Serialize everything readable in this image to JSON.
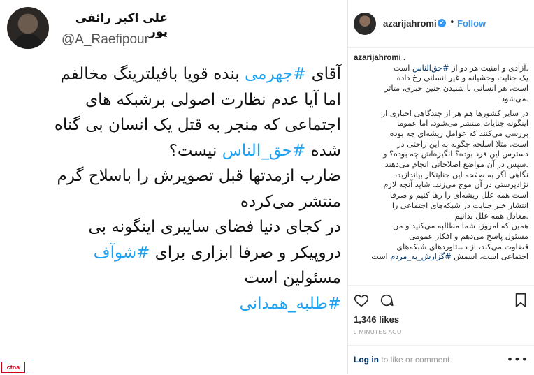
{
  "tweet": {
    "name": "علی اکبر رائفی پور",
    "handle": "@A_Raefipour",
    "lines": [
      {
        "a": "آقای ",
        "h": "#جهرمی",
        "b": " بنده قویا بافیلترینگ مخالفم"
      },
      {
        "a": "اما آیا عدم نظارت اصولی برشبکه های",
        "h": "",
        "b": ""
      },
      {
        "a": "اجتماعی که منجر به قتل یک انسان بی گناه",
        "h": "",
        "b": ""
      },
      {
        "a": "شده ",
        "h": "#حق_الناس",
        "b": " نیست؟"
      },
      {
        "a": "ضارب ازمدتها قبل تصویرش را باسلاح گرم",
        "h": "",
        "b": ""
      },
      {
        "a": "منتشر می‌کرده",
        "h": "",
        "b": ""
      },
      {
        "a": "در کجای دنیا فضای سایبری اینگونه بی",
        "h": "",
        "b": ""
      },
      {
        "a": "دروپیکر و صرفا ابزاری برای ",
        "h": "#شوآف",
        "b": ""
      },
      {
        "a": "مسئولین است",
        "h": "",
        "b": ""
      },
      {
        "a": "",
        "h": "#طلبه_همدانی",
        "b": ""
      }
    ]
  },
  "watermark": "ctna",
  "instagram": {
    "username": "azarijahromi",
    "follow_label": "Follow",
    "caption_user": "azarijahromi .",
    "caption_lines": [
      {
        "t": ".آزادی و امنیت هر دو از ",
        "h": "#حق‌الناس",
        "e": " است"
      },
      {
        "t": "یک جنایت وحشیانه و غیر انسانی رخ داده",
        "h": "",
        "e": ""
      },
      {
        "t": "است، هر انسانی با شنیدن چنین خبری، متاثر",
        "h": "",
        "e": ""
      },
      {
        "t": ".می‌شود",
        "h": "",
        "e": ""
      },
      {
        "t": "",
        "h": "",
        "e": "",
        "gap": true
      },
      {
        "t": "در سایر کشورها هم هر از چندگاهی اخباری از",
        "h": "",
        "e": ""
      },
      {
        "t": "اینگونه جنایات منتشر می‌شود، اما عموما",
        "h": "",
        "e": ""
      },
      {
        "t": "بررسی می‌کنند که عوامل ریشه‌ای چه بوده",
        "h": "",
        "e": ""
      },
      {
        "t": "است. مثلا اسلحه چگونه به این راحتی در",
        "h": "",
        "e": ""
      },
      {
        "t": "دسترس این فرد بوده؟ انگیزه‌اش چه بوده؟ و",
        "h": "",
        "e": ""
      },
      {
        "t": ".سپس در آن مواضع اصلاحاتی انجام می‌دهند",
        "h": "",
        "e": ""
      },
      {
        "t": "نگاهی اگر به صفحه این جنایتکار بیاندازید،",
        "h": "",
        "e": ""
      },
      {
        "t": "نژادپرستی در آن موج می‌زند. شاید آنچه لازم",
        "h": "",
        "e": ""
      },
      {
        "t": "است همه علل ریشه‌ای را رها کنیم و صرفا",
        "h": "",
        "e": ""
      },
      {
        "t": "انتشار خبر جنایت در شبکه‌های اجتماعی را",
        "h": "",
        "e": ""
      },
      {
        "t": ".معادل همه علل بدانیم",
        "h": "",
        "e": ""
      },
      {
        "t": "همین که امروز، شما مطالبه می‌کنید و من",
        "h": "",
        "e": ""
      },
      {
        "t": "مسئول پاسخ می‌دهم و افکار عمومی",
        "h": "",
        "e": ""
      },
      {
        "t": "قضاوت می‌کند، از دستاوردهای شبکه‌های",
        "h": "",
        "e": ""
      },
      {
        "t": "اجتماعی است، اسمش ",
        "h": "#گزارش_به_مردم",
        "e": " است"
      }
    ],
    "likes": "1,346 likes",
    "time": "9 MINUTES AGO",
    "login_link": "Log in",
    "login_rest": " to like or comment.",
    "more": "•••"
  }
}
